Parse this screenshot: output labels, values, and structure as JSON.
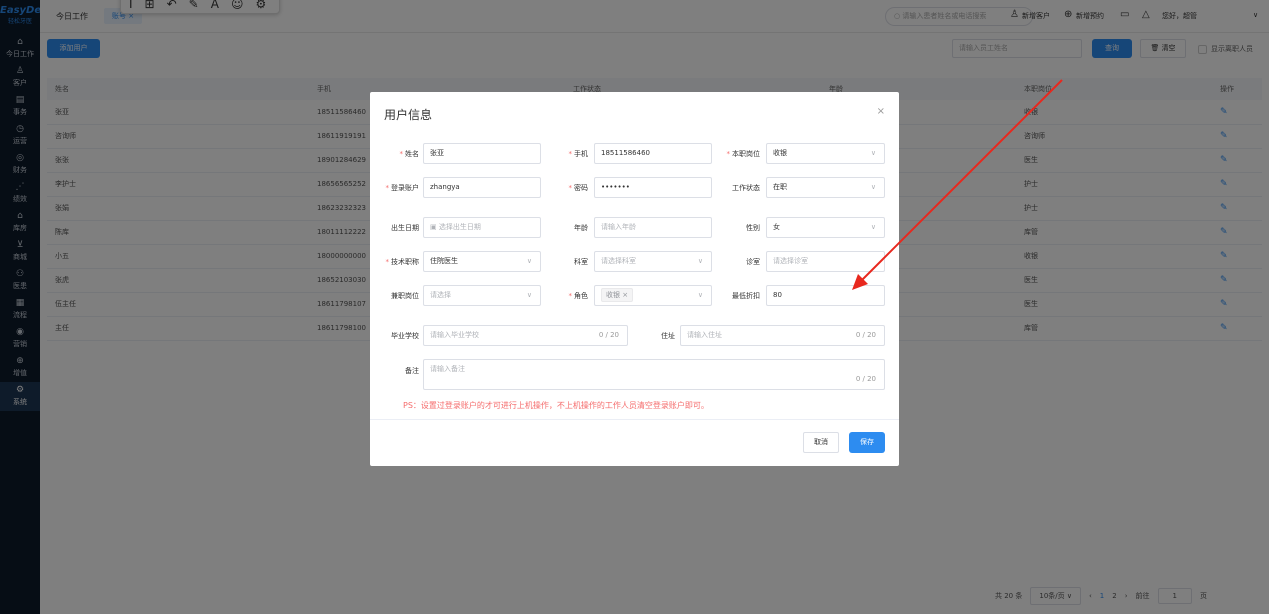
{
  "brand": {
    "name": "EasyDent",
    "subtitle": "轻松牙医"
  },
  "sidebar": {
    "items": [
      {
        "label": "今日工作",
        "icon": "⌂"
      },
      {
        "label": "客户",
        "icon": "♙"
      },
      {
        "label": "事务",
        "icon": "▤"
      },
      {
        "label": "运营",
        "icon": "◷"
      },
      {
        "label": "财务",
        "icon": "◎"
      },
      {
        "label": "绩效",
        "icon": "⋰"
      },
      {
        "label": "库房",
        "icon": "⌂"
      },
      {
        "label": "商城",
        "icon": "⊻"
      },
      {
        "label": "医患",
        "icon": "⚇"
      },
      {
        "label": "流程",
        "icon": "▦"
      },
      {
        "label": "营销",
        "icon": "◉"
      },
      {
        "label": "增值",
        "icon": "⊕"
      },
      {
        "label": "系统",
        "icon": "⚙"
      }
    ]
  },
  "topbar": {
    "tab_today": "今日工作",
    "tab_account": "账号",
    "tab_close": "×",
    "search_placeholder": "请输入患者姓名或电话搜索",
    "new_customer": "新增客户",
    "new_appointment": "新增预约",
    "greeting": "您好，超管"
  },
  "toolbar": {
    "add_user": "添加用户",
    "staff_search_placeholder": "请输入员工姓名",
    "query": "查询",
    "clear": "清空",
    "show_resigned": "显示离职人员"
  },
  "table": {
    "columns": [
      "姓名",
      "手机",
      "工作状态",
      "年龄",
      "本职岗位",
      "操作"
    ],
    "rows": [
      [
        "张亚",
        "18511586460",
        "",
        "",
        "收银"
      ],
      [
        "咨询师",
        "18611919191",
        "",
        "",
        "咨询师"
      ],
      [
        "张张",
        "18901284629",
        "",
        "",
        "医生"
      ],
      [
        "李护士",
        "18656565252",
        "",
        "",
        "护士"
      ],
      [
        "张娟",
        "18623232323",
        "",
        "",
        "护士"
      ],
      [
        "陈库",
        "18011112222",
        "",
        "",
        "库管"
      ],
      [
        "小五",
        "18000000000",
        "",
        "",
        "收银"
      ],
      [
        "张虎",
        "18652103030",
        "",
        "",
        "医生"
      ],
      [
        "伍主任",
        "18611798107",
        "",
        "",
        "医生"
      ],
      [
        "主任",
        "18611798100",
        "",
        "",
        "库管"
      ]
    ]
  },
  "pagination": {
    "total": "共 20 条",
    "page_size": "10条/页",
    "page1": "1",
    "page2": "2",
    "goto_label": "前往",
    "goto_value": "1",
    "page_unit": "页"
  },
  "modal": {
    "title": "用户信息",
    "close": "×",
    "fields": {
      "name": {
        "label": "姓名",
        "value": "张亚"
      },
      "phone": {
        "label": "手机",
        "value": "18511586460"
      },
      "position": {
        "label": "本职岗位",
        "value": "收银"
      },
      "login_account": {
        "label": "登录账户",
        "value": "zhangya"
      },
      "password": {
        "label": "密码",
        "value": "•••••••"
      },
      "work_status": {
        "label": "工作状态",
        "value": "在职"
      },
      "birth_date": {
        "label": "出生日期",
        "placeholder": "选择出生日期"
      },
      "age": {
        "label": "年龄",
        "placeholder": "请输入年龄"
      },
      "gender": {
        "label": "性别",
        "value": "女"
      },
      "tech_title": {
        "label": "技术职称",
        "value": "住院医生"
      },
      "department": {
        "label": "科室",
        "placeholder": "请选择科室"
      },
      "clinic_room": {
        "label": "诊室",
        "placeholder": "请选择诊室"
      },
      "part_time_position": {
        "label": "兼职岗位",
        "placeholder": "请选择"
      },
      "role": {
        "label": "角色",
        "tag": "收银",
        "tag_close": "×"
      },
      "min_discount": {
        "label": "最低折扣",
        "value": "80"
      },
      "school": {
        "label": "毕业学校",
        "placeholder": "请输入毕业学校",
        "counter": "0 / 20"
      },
      "address": {
        "label": "住址",
        "placeholder": "请输入住址",
        "counter": "0 / 20"
      },
      "remark": {
        "label": "备注",
        "placeholder": "请输入备注",
        "counter": "0 / 20"
      }
    },
    "ps_note": "PS：设置过登录账户的才可进行上机操作，不上机操作的工作人员清空登录账户即可。",
    "cancel": "取消",
    "save": "保存"
  },
  "colors": {
    "primary": "#2d8cf0",
    "sidebar": "#0d1a2b",
    "annotation_arrow": "#e8281e"
  }
}
